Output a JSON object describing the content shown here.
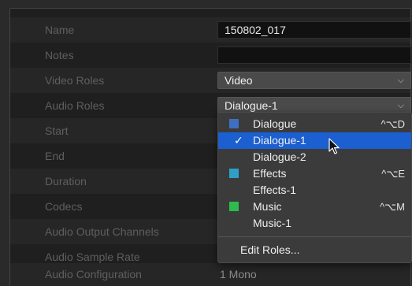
{
  "inspector": {
    "rows": [
      {
        "label": "Name"
      },
      {
        "label": "Notes"
      },
      {
        "label": "Video Roles"
      },
      {
        "label": "Audio Roles"
      },
      {
        "label": "Start"
      },
      {
        "label": "End"
      },
      {
        "label": "Duration"
      },
      {
        "label": "Codecs"
      },
      {
        "label": "Audio Output Channels"
      },
      {
        "label": "Audio Sample Rate"
      },
      {
        "label": "Audio Configuration"
      }
    ],
    "name_value": "150802_017",
    "notes_value": "",
    "video_roles_value": "Video",
    "audio_roles_value": "Dialogue-1",
    "audio_configuration_value": "1 Mono"
  },
  "menu": {
    "items": [
      {
        "label": "Dialogue",
        "shortcut": "^⌥D",
        "swatch": "#3f6fc0"
      },
      {
        "label": "Dialogue-1",
        "check": "✓"
      },
      {
        "label": "Dialogue-2"
      },
      {
        "label": "Effects",
        "shortcut": "^⌥E",
        "swatch": "#2ea0c7"
      },
      {
        "label": "Effects-1"
      },
      {
        "label": "Music",
        "shortcut": "^⌥M",
        "swatch": "#2dbb4d"
      },
      {
        "label": "Music-1"
      },
      {
        "label": "Edit Roles..."
      }
    ]
  },
  "colors": {
    "selection": "#1b5fd1",
    "dialogue": "#3f6fc0",
    "effects": "#2ea0c7",
    "music": "#2dbb4d"
  },
  "icons": {
    "chevron": "chevron-down-icon",
    "checkmark": "checkmark-icon",
    "pointer": "mouse-pointer-icon"
  }
}
